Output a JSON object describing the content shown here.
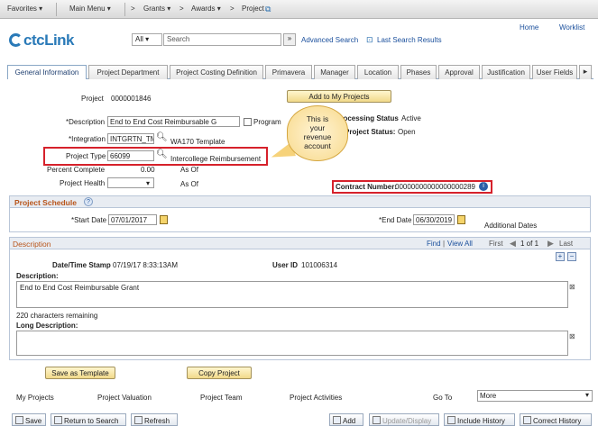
{
  "topnav": {
    "favorites": "Favorites ▾",
    "main_menu": "Main Menu ▾",
    "crumb1": "Grants ▾",
    "crumb2": "Awards ▾",
    "crumb3": "Project"
  },
  "header": {
    "logo": "ctcLink",
    "home": "Home",
    "worklist": "Worklist",
    "search_scope": "All",
    "search_placeholder": "Search",
    "advanced_search": "Advanced Search",
    "last_search_results": "Last Search Results"
  },
  "tabs": [
    "General Information",
    "Project Department",
    "Project Costing Definition",
    "Primavera",
    "Manager",
    "Location",
    "Phases",
    "Approval",
    "Justification",
    "User Fields"
  ],
  "project": {
    "label": "Project",
    "value": "0000001846",
    "add_to_my_projects": "Add to My Projects",
    "description_label": "*Description",
    "description_value": "End to End Cost Reimbursable G",
    "program_label": "Program",
    "processing_status_label": "Processing Status",
    "processing_status_value": "Active",
    "integration_label": "*Integration",
    "integration_value": "INTGRTN_TMP",
    "integration_desc": "WA170 Template",
    "project_status_label": "Project Status:",
    "project_status_value": "Open",
    "project_type_label": "Project Type",
    "project_type_value": "66099",
    "project_type_desc": "Intercollege Reimbursement",
    "percent_complete_label": "Percent Complete",
    "percent_complete_value": "0.00",
    "as_of_1": "As Of",
    "project_health_label": "Project Health",
    "as_of_2": "As Of",
    "contract_number_label": "Contract Number:",
    "contract_number_value": "00000000000000000289"
  },
  "callout": {
    "line1": "This is",
    "line2": "your",
    "line3": "revenue",
    "line4": "account"
  },
  "schedule": {
    "title": "Project Schedule",
    "start_label": "*Start Date",
    "start_value": "07/01/2017",
    "end_label": "*End Date",
    "end_value": "06/30/2019",
    "additional_dates": "Additional Dates"
  },
  "description_section": {
    "title": "Description",
    "find": "Find",
    "view_all": "View All",
    "first": "First",
    "range": "1 of 1",
    "last": "Last",
    "datetime_label": "Date/Time Stamp",
    "datetime_value": "07/19/17  8:33:13AM",
    "userid_label": "User ID",
    "userid_value": "101006314",
    "description_label": "Description:",
    "description_value": "End to End Cost Reimbursable Grant",
    "chars_remaining": "220 characters remaining",
    "long_description_label": "Long Description:"
  },
  "actions": {
    "save_as_template": "Save as Template",
    "copy_project": "Copy Project"
  },
  "links": {
    "my_projects": "My Projects",
    "project_valuation": "Project Valuation",
    "project_team": "Project Team",
    "project_activities": "Project Activities",
    "go_to": "Go To",
    "more": "More"
  },
  "toolbar": {
    "save": "Save",
    "return_to_search": "Return to Search",
    "refresh": "Refresh",
    "add": "Add",
    "update_display": "Update/Display",
    "include_history": "Include History",
    "correct_history": "Correct History"
  },
  "colors": {
    "highlight_red": "#d6212b",
    "link_blue": "#1a4f9c",
    "section_orange": "#b8541a"
  }
}
